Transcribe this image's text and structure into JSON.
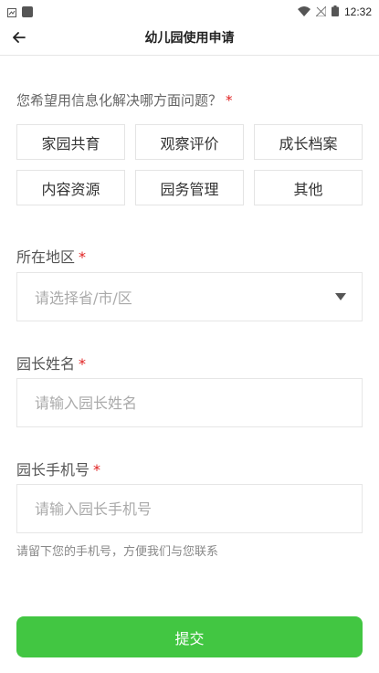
{
  "status_bar": {
    "time": "12:32"
  },
  "nav": {
    "title": "幼儿园使用申请"
  },
  "question": {
    "label": "您希望用信息化解决哪方面问题？",
    "required_mark": "*"
  },
  "options": [
    {
      "label": "家园共育"
    },
    {
      "label": "观察评价"
    },
    {
      "label": "成长档案"
    },
    {
      "label": "内容资源"
    },
    {
      "label": "园务管理"
    },
    {
      "label": "其他"
    }
  ],
  "region": {
    "label": "所在地区",
    "required_mark": "*",
    "placeholder": "请选择省/市/区"
  },
  "principal_name": {
    "label": "园长姓名",
    "required_mark": "*",
    "placeholder": "请输入园长姓名"
  },
  "principal_phone": {
    "label": "园长手机号",
    "required_mark": "*",
    "placeholder": "请输入园长手机号",
    "hint": "请留下您的手机号，方便我们与您联系"
  },
  "submit": {
    "label": "提交"
  },
  "colors": {
    "accent_green": "#42c642",
    "required_red": "#e02020"
  }
}
